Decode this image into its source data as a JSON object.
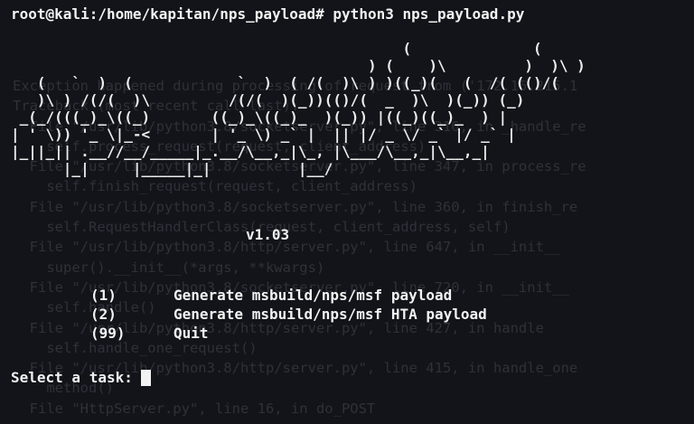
{
  "terminal": {
    "prompt": "root@kali:/home/kapitan/nps_payload# python3 nps_payload.py",
    "background_text": [
      "Exception happened during processing of request from ('172.16.215.1",
      "Traceback (most recent call last):",
      "  File \"/usr/lib/python3.8/socketserver.py\", line 316, in _handle_re",
      "    self.process_request(request, client_address)",
      "  File \"/usr/lib/python3.8/socketserver.py\", line 347, in process_re",
      "    self.finish_request(request, client_address)",
      "  File \"/usr/lib/python3.8/socketserver.py\", line 360, in finish_re",
      "    self.RequestHandlerClass(request, client_address, self)",
      "  File \"/usr/lib/python3.8/http/server.py\", line 647, in __init__",
      "    super().__init__(*args, **kwargs)",
      "  File \"/usr/lib/python3.8/socketserver.py\", line 720, in __init__",
      "    self.handle()",
      "  File \"/usr/lib/python3.8/http/server.py\", line 427, in handle",
      "    self.handle_one_request()",
      "  File \"/usr/lib/python3.8/http/server.py\", line 415, in handle_one",
      "    method()",
      "  File \"HttpServer.py\", line 16, in do_POST"
    ],
    "banner_lines": [
      "                                             (              (",
      "                                         ) (    )\\         )  )\\ )",
      "   (   `  )  (            `  )  ( /(  )\\ ) )((_)(   (  /( (()/(",
      "   )\\ ) /(/(  )\\         /(/(  )(_))(()/(  _  )\\  )(_)) (_)",
      " _(_/(((_)_\\((_)       ((_)_\\((_)_  )(_)) |((_)((_)_  ) |",
      "| ' \\)) '_ \\|_-<       | '_ \\) _` |  || |/ _ \\/ _` |/ _` |",
      "|_||_|| .__//__/_____|_.__/\\__,_|\\_, |\\___/\\__,_|\\__,_|",
      "      |_|     |_____|_|          |__/"
    ],
    "version": "v1.03",
    "menu": [
      {
        "key": "(1)",
        "label": "Generate msbuild/nps/msf payload"
      },
      {
        "key": "(2)",
        "label": "Generate msbuild/nps/msf HTA payload"
      },
      {
        "key": "(99)",
        "label": "Quit"
      }
    ],
    "input_prompt": "Select a task:"
  }
}
